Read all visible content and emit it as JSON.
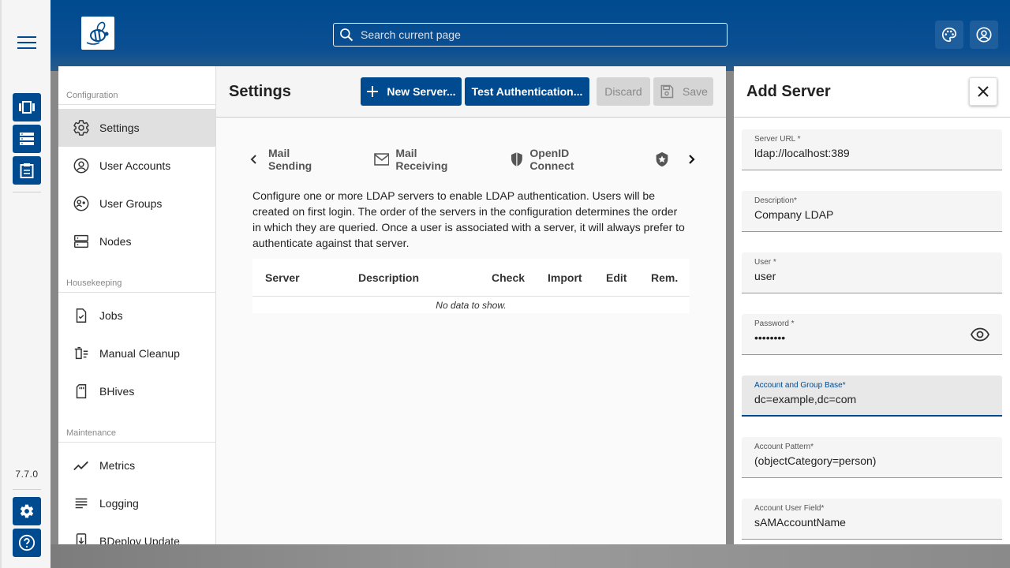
{
  "rail": {
    "version": "7.7.0",
    "accent": "#004a8f"
  },
  "header": {
    "search_placeholder": "Search current page",
    "bg_color": "#004a8f"
  },
  "nav": {
    "sections": {
      "configuration": "Configuration",
      "housekeeping": "Housekeeping",
      "maintenance": "Maintenance"
    },
    "items": [
      {
        "label": "Settings",
        "icon": "gear-icon",
        "active": true
      },
      {
        "label": "User Accounts",
        "icon": "account-circle-icon"
      },
      {
        "label": "User Groups",
        "icon": "group-icon"
      },
      {
        "label": "Nodes",
        "icon": "nodes-icon"
      },
      {
        "label": "Jobs",
        "icon": "jobs-icon"
      },
      {
        "label": "Manual Cleanup",
        "icon": "cleanup-icon"
      },
      {
        "label": "BHives",
        "icon": "sd-card-icon"
      },
      {
        "label": "Metrics",
        "icon": "metrics-icon"
      },
      {
        "label": "Logging",
        "icon": "logging-icon"
      },
      {
        "label": "BDeploy Update",
        "icon": "system-update-icon"
      }
    ]
  },
  "main": {
    "title": "Settings",
    "buttons": {
      "new_server": "New Server...",
      "test_auth": "Test Authentication...",
      "discard": "Discard",
      "save": "Save"
    },
    "tabs": [
      "Mail Sending",
      "Mail Receiving",
      "OpenID Connect"
    ],
    "description": "Configure one or more LDAP servers to enable LDAP authentication. Users will be created on first login. The order of the servers in the configuration determines the order in which they are queried. Once a user is associated with a server, it will always prefer to authenticate against that server.",
    "table": {
      "columns": [
        "Server",
        "Description",
        "Check",
        "Import",
        "Edit",
        "Rem."
      ],
      "empty_text": "No data to show."
    }
  },
  "panel": {
    "title": "Add Server",
    "fields": [
      {
        "label": "Server URL *",
        "value": "ldap://localhost:389"
      },
      {
        "label": "Description*",
        "value": "Company LDAP"
      },
      {
        "label": "User *",
        "value": "user"
      },
      {
        "label": "Password *",
        "value": "••••••••"
      },
      {
        "label": "Account and Group Base*",
        "value": "dc=example,dc=com"
      },
      {
        "label": "Account Pattern*",
        "value": "(objectCategory=person)"
      },
      {
        "label": "Account User Field*",
        "value": "sAMAccountName"
      }
    ]
  }
}
